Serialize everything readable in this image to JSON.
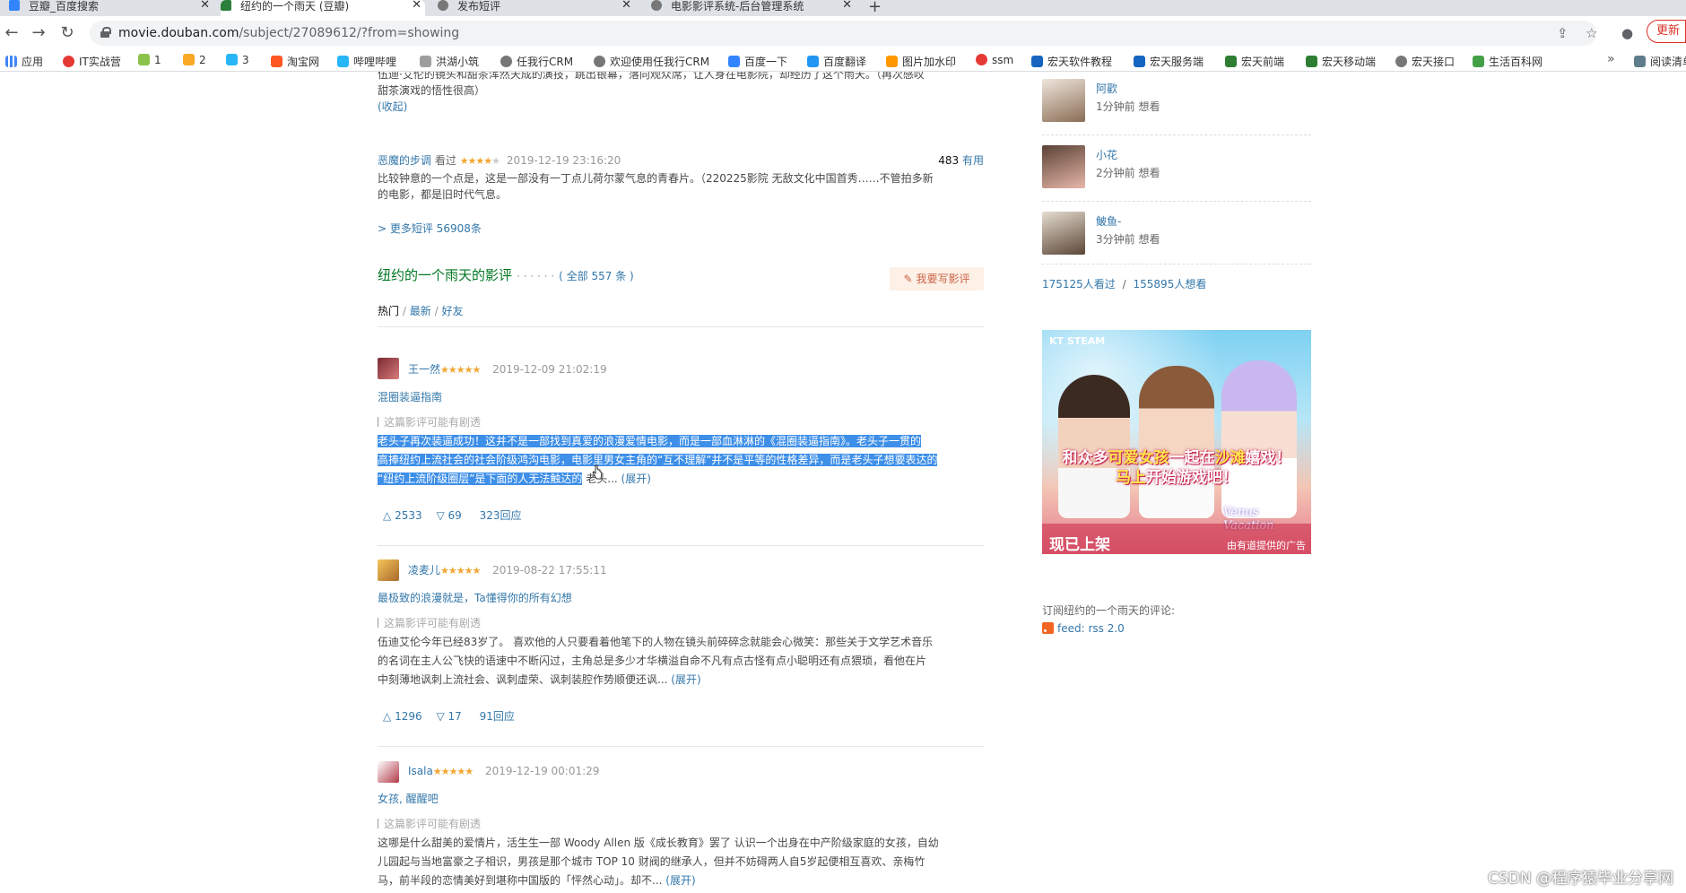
{
  "browser": {
    "tabs": [
      {
        "title": "豆瓣_百度搜索"
      },
      {
        "title": "纽约的一个雨天 (豆瓣)"
      },
      {
        "title": "发布短评"
      },
      {
        "title": "电影影评系统-后台管理系统"
      }
    ],
    "new_tab": "+",
    "url_host": "movie.douban.com",
    "url_path": "/subject/27089612/?from=showing",
    "update_label": "更新",
    "bookmarks": [
      "应用",
      "IT实战营",
      "1",
      "2",
      "3",
      "淘宝网",
      "哔哩哔哩",
      "洪湖小筑",
      "任我行CRM",
      "欢迎使用任我行CRM",
      "百度一下",
      "百度翻译",
      "图片加水印",
      "ssm",
      "宏天软件教程",
      "宏天服务端",
      "宏天前端",
      "宏天移动端",
      "宏天接口",
      "生活百科网",
      "阅读清单"
    ],
    "bookmarks_more": "»"
  },
  "top_review": {
    "text_line1": "伍迪·艾伦的镜头和甜茶浑然天成的演技，跳出银幕，落向观众席，让人身在电影院，却经历了这个雨天。（再次感叹",
    "text_line2": "甜茶演戏的悟性很高）",
    "collapse": "(收起)"
  },
  "short_comment": {
    "author": "恶魔的步调",
    "status": "看过",
    "stars": "★★★★",
    "stars_off": "★",
    "time": "2019-12-19 23:16:20",
    "useful_count": "483",
    "useful_label": "有用",
    "text_line1": "比较钟意的一个点是，这是一部没有一丁点儿荷尔蒙气息的青春片。（220225影院 无敌文化中国首秀……不管拍多新",
    "text_line2": "的电影，都是旧时代气息。"
  },
  "more_comments": "> 更多短评 56908条",
  "reviews_section": {
    "title": "纽约的一个雨天的影评",
    "dots": "· · · · · ·",
    "all_count": "( 全部 557 条 )",
    "write_button": "我要写影评",
    "filters": [
      "热门",
      "最新",
      "好友"
    ]
  },
  "reviews": [
    {
      "author": "王一然",
      "stars": "★★★★★",
      "time": "2019-12-09 21:02:19",
      "title": "混圈装逼指南",
      "spoiler": "这篇影评可能有剧透",
      "selected_line1": "老头子再次装逼成功！这并不是一部找到真爱的浪漫爱情电影，而是一部血淋淋的《混圈装逼指南》。老头子一贯的",
      "selected_line2": "高捧纽约上流社会的社会阶级鸿沟电影，电影里男女主角的“互不理解”并不是平等的性格差异，而是老头子想要表达的",
      "selected_line3": "“纽约上流阶级圈层”是下面的人无法触达的",
      "rest_line3": "老头...",
      "expand": "(展开)",
      "up": "2533",
      "down": "69",
      "replies": "323回应"
    },
    {
      "author": "凌麦儿",
      "stars": "★★★★★",
      "time": "2019-08-22 17:55:11",
      "title": "最极致的浪漫就是，Ta懂得你的所有幻想",
      "spoiler": "这篇影评可能有剧透",
      "line1": "伍迪艾伦今年已经83岁了。 喜欢他的人只要看着他笔下的人物在镜头前碎碎念就能会心微笑：那些关于文学艺术音乐",
      "line2": "的名词在主人公飞快的语速中不断闪过，主角总是多少才华横溢自命不凡有点古怪有点小聪明还有点猥琐，看他在片",
      "line3": "中刻薄地讽刺上流社会、讽刺虚荣、讽刺装腔作势顺便还讽...",
      "expand": "(展开)",
      "up": "1296",
      "down": "17",
      "replies": "91回应"
    },
    {
      "author": "Isala",
      "stars": "★★★★★",
      "time": "2019-12-19 00:01:29",
      "title": "女孩, 醒醒吧",
      "spoiler": "这篇影评可能有剧透",
      "line1": "这哪是什么甜美的爱情片，活生生一部 Woody Allen 版《成长教育》罢了 认识一个出身在中产阶级家庭的女孩，自幼",
      "line2": "儿园起与当地富豪之子相识，男孩是那个城市 TOP 10 财阀的继承人，但并不妨碍两人自5岁起便相互喜欢、亲梅竹",
      "line3": "马，前半段的恋情美好到堪称中国版的「怦然心动」。却不...",
      "expand": "(展开)"
    }
  ],
  "sidebar": {
    "users": [
      {
        "name": "阿歡",
        "status": "1分钟前 想看"
      },
      {
        "name": "小花",
        "status": "2分钟前 想看"
      },
      {
        "name": "鲏鱼-",
        "status": "3分钟前 想看"
      }
    ],
    "watched": "175125人看过",
    "sep": "/",
    "wish": "155895人想看",
    "ad": {
      "brand": "KT STEAM",
      "headline_a": "和众多",
      "headline_b": "可爱女孩",
      "headline_c": "一起在",
      "headline_d": "沙滩",
      "headline_e": "嬉戏！",
      "headline_f": "马上",
      "headline_g": "开始游戏吧！",
      "released": "现已上架",
      "logo": "Venus Vacation",
      "note": "由有道提供的广告"
    },
    "subscribe": "订阅纽约的一个雨天的评论:",
    "feed": "feed: rss 2.0"
  },
  "watermark": "CSDN @程序猿毕业分享网",
  "colors": {
    "link": "#3377aa",
    "selection": "#3e8fe8",
    "star": "#f3a632",
    "section_title": "#007722"
  }
}
